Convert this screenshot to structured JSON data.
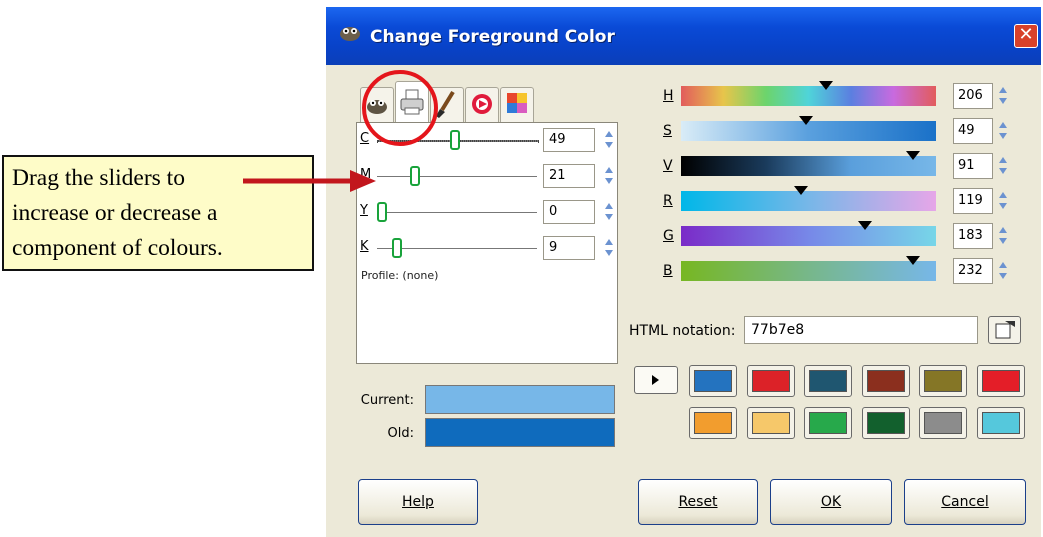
{
  "callout": {
    "lines": [
      "Drag the sliders to",
      "increase or decrease a",
      "component of colours."
    ]
  },
  "window": {
    "title": "Change Foreground Color",
    "close_glyph": "✕"
  },
  "cmyk": {
    "channels": [
      {
        "label": "C",
        "value": "49",
        "level": 0.49
      },
      {
        "label": "M",
        "value": "21",
        "level": 0.21
      },
      {
        "label": "Y",
        "value": "0",
        "level": 0.0
      },
      {
        "label": "K",
        "value": "9",
        "level": 0.09
      }
    ],
    "profile_text": "Profile: (none)"
  },
  "colors": {
    "current_label": "Current:",
    "old_label": "Old:",
    "current_hex": "#77b7e8",
    "old_hex": "#0f6bbd"
  },
  "hsv_rgb": [
    {
      "label": "H",
      "value": "206",
      "level": 0.57
    },
    {
      "label": "S",
      "value": "49",
      "level": 0.49
    },
    {
      "label": "V",
      "value": "91",
      "level": 0.91
    },
    {
      "label": "R",
      "value": "119",
      "level": 0.47
    },
    {
      "label": "G",
      "value": "183",
      "level": 0.72
    },
    {
      "label": "B",
      "value": "232",
      "level": 0.91
    }
  ],
  "html_notation": {
    "label": "HTML notation:",
    "value": "77b7e8"
  },
  "history_swatches": [
    "#2473bf",
    "#dc2228",
    "#1f5670",
    "#8b2f1e",
    "#857626",
    "#e41e28",
    "#f29d2e",
    "#f6c86a",
    "#27a94b",
    "#12602d",
    "#8c8c8c",
    "#55c8dc"
  ],
  "buttons": {
    "help": "Help",
    "reset": "Reset",
    "ok": "OK",
    "cancel": "Cancel"
  },
  "icons": [
    "gimp-icon",
    "printer-icon",
    "brush-icon",
    "color-wheel-icon",
    "palette-icon",
    "color-picker-icon"
  ]
}
